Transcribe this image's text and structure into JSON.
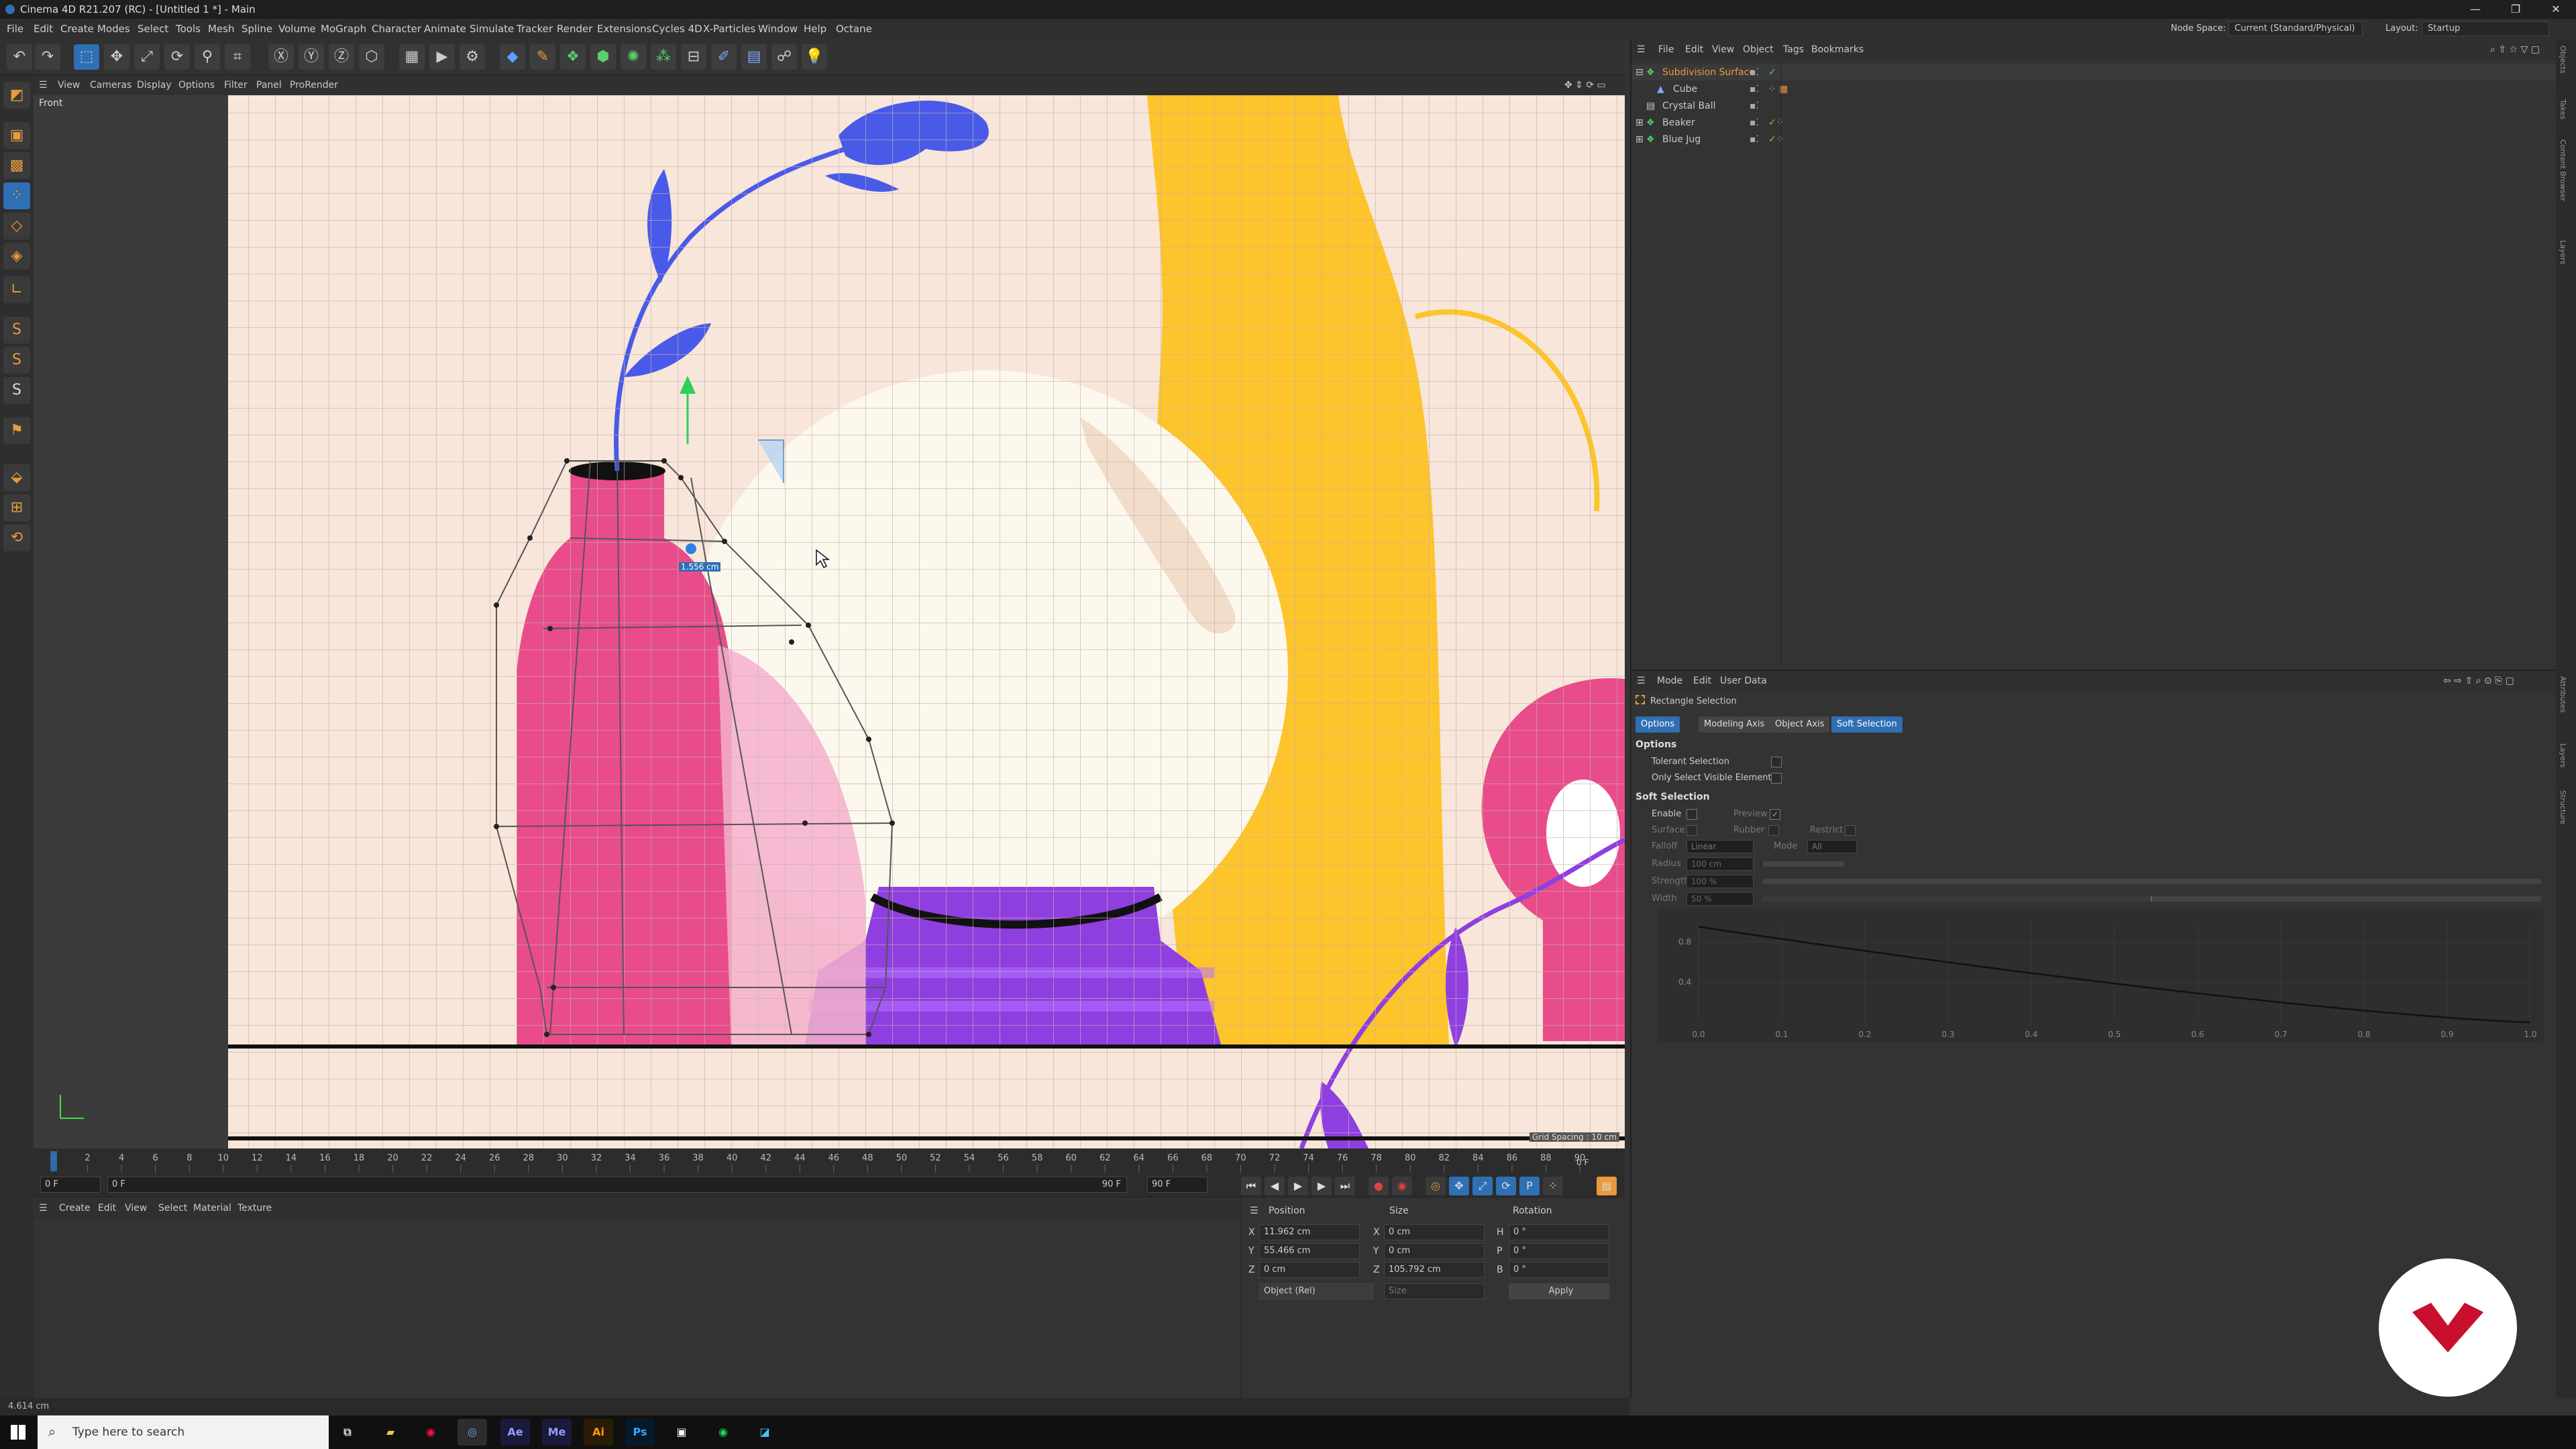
{
  "window": {
    "title": "Cinema 4D R21.207 (RC) - [Untitled 1 *] - Main",
    "controls": [
      "—",
      "❐",
      "✕"
    ]
  },
  "menu": {
    "items": [
      "File",
      "Edit",
      "Create",
      "Modes",
      "Select",
      "Tools",
      "Mesh",
      "Spline",
      "Volume",
      "MoGraph",
      "Character",
      "Animate",
      "Simulate",
      "Tracker",
      "Render",
      "Extensions",
      "Cycles 4D",
      "X-Particles",
      "Window",
      "Help",
      "Octane"
    ],
    "node_space_label": "Node Space:",
    "node_space_value": "Current (Standard/Physical)",
    "layout_label": "Layout:",
    "layout_value": "Startup"
  },
  "viewport": {
    "menu": [
      "View",
      "Cameras",
      "Display",
      "Options",
      "Filter",
      "Panel",
      "ProRender"
    ],
    "label": "Front",
    "measure": "1.556 cm",
    "grid_spacing": "Grid Spacing : 10 cm"
  },
  "timeline": {
    "ticks": [
      "0",
      "2",
      "4",
      "6",
      "8",
      "10",
      "12",
      "14",
      "16",
      "18",
      "20",
      "22",
      "24",
      "26",
      "28",
      "30",
      "32",
      "34",
      "36",
      "38",
      "40",
      "42",
      "44",
      "46",
      "48",
      "50",
      "52",
      "54",
      "56",
      "58",
      "60",
      "62",
      "64",
      "66",
      "68",
      "70",
      "72",
      "74",
      "76",
      "78",
      "80",
      "82",
      "84",
      "86",
      "88",
      "90"
    ],
    "current_frame": "0 F",
    "start": "0 F",
    "range_start": "0 F",
    "range_end": "90 F",
    "end": "90 F",
    "frame_display": "0 F"
  },
  "material": {
    "menu": [
      "Create",
      "Edit",
      "View",
      "Select",
      "Material",
      "Texture"
    ]
  },
  "coordinates": {
    "headers": [
      "Position",
      "Size",
      "Rotation"
    ],
    "rows": [
      {
        "axis": "X",
        "pos": "11.962 cm",
        "saxis": "X",
        "size": "0 cm",
        "raxis": "H",
        "rot": "0 °"
      },
      {
        "axis": "Y",
        "pos": "55.466 cm",
        "saxis": "Y",
        "size": "0 cm",
        "raxis": "P",
        "rot": "0 °"
      },
      {
        "axis": "Z",
        "pos": "0 cm",
        "saxis": "Z",
        "size": "105.792 cm",
        "raxis": "B",
        "rot": "0 °"
      }
    ],
    "mode": "Object (Rel)",
    "size_mode": "Size",
    "apply": "Apply"
  },
  "objects": {
    "menu": [
      "File",
      "Edit",
      "View",
      "Object",
      "Tags",
      "Bookmarks"
    ],
    "items": [
      {
        "name": "Subdivision Surface",
        "indent": 0,
        "color": "#e89a3c"
      },
      {
        "name": "Cube",
        "indent": 1,
        "color": "#d0d0d0"
      },
      {
        "name": "Crystal Ball",
        "indent": 0,
        "color": "#d0d0d0"
      },
      {
        "name": "Beaker",
        "indent": 0,
        "color": "#d0d0d0"
      },
      {
        "name": "Blue Jug",
        "indent": 0,
        "color": "#d0d0d0"
      }
    ]
  },
  "attributes": {
    "menu": [
      "Mode",
      "Edit",
      "User Data"
    ],
    "title": "Rectangle Selection",
    "tabs": [
      "Options",
      "Modeling Axis",
      "Object Axis",
      "Soft Selection"
    ],
    "options_header": "Options",
    "tolerant": "Tolerant Selection",
    "only_visible": "Only Select Visible Elements",
    "soft_header": "Soft Selection",
    "enable": "Enable",
    "preview": "Preview",
    "surface": "Surface",
    "rubber": "Rubber",
    "restrict": "Restrict",
    "falloff_label": "Falloff",
    "falloff_value": "Linear",
    "mode_label": "Mode",
    "mode_value": "All",
    "radius_label": "Radius",
    "radius_value": "100 cm",
    "strength_label": "Strength",
    "strength_value": "100 %",
    "width_label": "Width",
    "width_value": "50 %",
    "graph_x": [
      "0.0",
      "0.1",
      "0.2",
      "0.3",
      "0.4",
      "0.5",
      "0.6",
      "0.7",
      "0.8",
      "0.9",
      "1.0"
    ],
    "graph_y": [
      "0.8",
      "0.4"
    ]
  },
  "right_strip": [
    "Objects",
    "Takes",
    "Content Browser",
    "Layers",
    "Attributes",
    "Layers",
    "Structure"
  ],
  "status": {
    "text": "4.614 cm"
  },
  "taskbar": {
    "search_placeholder": "Type here to search",
    "apps": [
      "Ae",
      "Me",
      "Ai",
      "Ps"
    ]
  },
  "colors": {
    "bg": "#f7e6d9",
    "pink": "#e94c8b",
    "yellow": "#fdc42b",
    "purple": "#8f3fe0",
    "blue": "#4a5ae8",
    "ball": "#fdf8ee",
    "accent": "#2f6fb3"
  }
}
